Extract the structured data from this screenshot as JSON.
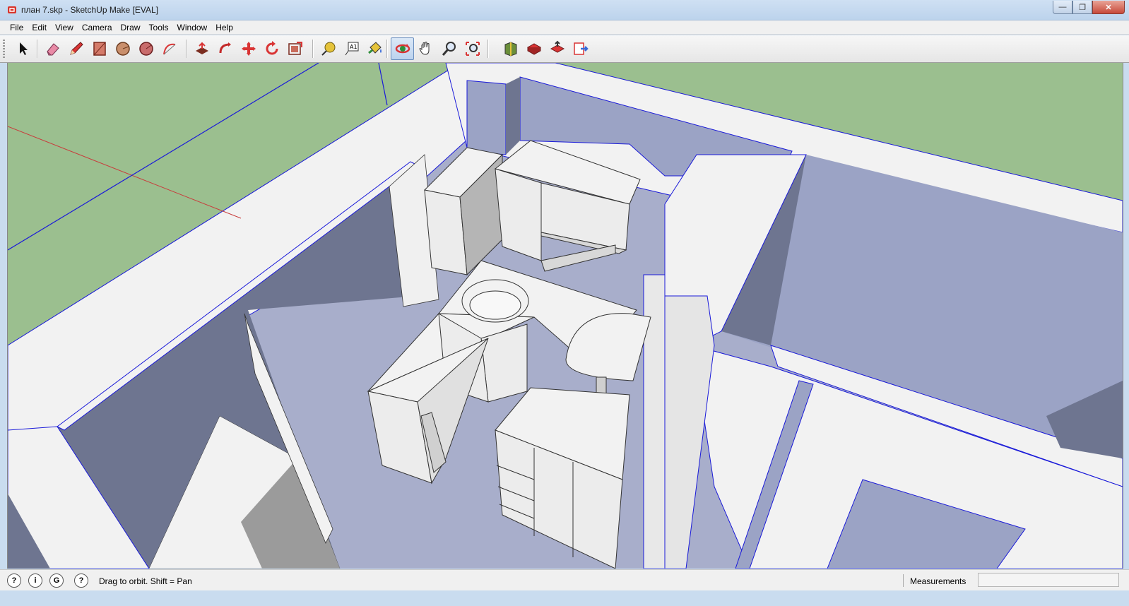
{
  "window": {
    "title": "план 7.skp - SketchUp Make [EVAL]",
    "controls": {
      "minimize": "—",
      "maximize": "❐",
      "close": "✕"
    }
  },
  "menu": [
    "File",
    "Edit",
    "View",
    "Camera",
    "Draw",
    "Tools",
    "Window",
    "Help"
  ],
  "toolbar": {
    "groups": [
      [
        "select-icon"
      ],
      [
        "eraser-icon",
        "pencil-icon",
        "rectangle-icon",
        "circle-icon",
        "polygon-icon",
        "arc-icon"
      ],
      [
        "push-pull-icon",
        "follow-me-icon",
        "move-icon",
        "rotate-icon",
        "offset-icon"
      ],
      [
        "tape-measure-icon",
        "text-icon",
        "paint-bucket-icon"
      ],
      [
        "orbit-icon",
        "pan-icon",
        "zoom-icon",
        "zoom-extents-icon"
      ],
      [
        "3d-warehouse-icon",
        "get-models-icon",
        "share-model-icon",
        "send-to-layout-icon"
      ]
    ],
    "active_tool": "orbit-icon"
  },
  "statusbar": {
    "hint": "Drag to orbit.  Shift = Pan",
    "measurements_label": "Measurements",
    "measurements_value": ""
  },
  "colors": {
    "ground": "#9bbf8f",
    "wall_top": "#f2f2f2",
    "wall_face": "#9ba3c5",
    "wall_dark": "#6e7590",
    "floor": "#a8aecb",
    "edge": "#1a1ad9",
    "axis_red": "#c83c3c"
  }
}
